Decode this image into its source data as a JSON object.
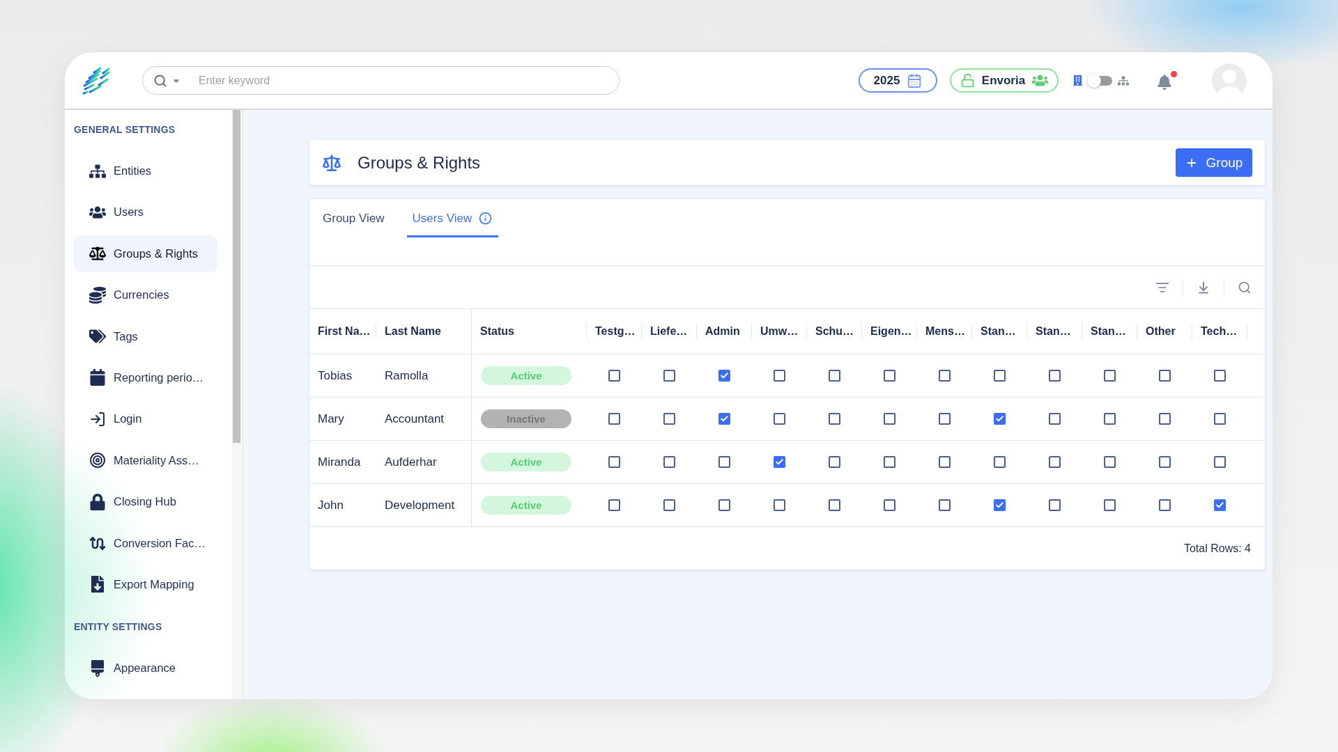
{
  "header": {
    "search": {
      "placeholder": "Enter keyword"
    },
    "year": "2025",
    "entity": "Envoria",
    "view_toggle": {
      "on": false
    },
    "notifications": {
      "unread": true
    }
  },
  "sidebar": {
    "sections": [
      {
        "title": "GENERAL SETTINGS",
        "items": [
          {
            "label": "Entities",
            "selected": false
          },
          {
            "label": "Users",
            "selected": false
          },
          {
            "label": "Groups & Rights",
            "selected": true
          },
          {
            "label": "Currencies",
            "selected": false
          },
          {
            "label": "Tags",
            "selected": false
          },
          {
            "label": "Reporting perio…",
            "selected": false
          },
          {
            "label": "Login",
            "selected": false
          },
          {
            "label": "Materiality Ass…",
            "selected": false
          },
          {
            "label": "Closing Hub",
            "selected": false
          },
          {
            "label": "Conversion Fac…",
            "selected": false
          },
          {
            "label": "Export Mapping",
            "selected": false
          }
        ]
      },
      {
        "title": "ENTITY SETTINGS",
        "items": [
          {
            "label": "Appearance",
            "selected": false
          }
        ]
      }
    ]
  },
  "page": {
    "title": "Groups & Rights",
    "add_button": "Group"
  },
  "tabs": [
    {
      "label": "Group View",
      "selected": false,
      "info": false
    },
    {
      "label": "Users View",
      "selected": true,
      "info": true
    }
  ],
  "table": {
    "columns": [
      "First Na…",
      "Last Name",
      "Status",
      "Testg…",
      "Liefe…",
      "Admin",
      "Umw…",
      "Schu…",
      "Eigen…",
      "Mens…",
      "Stan…",
      "Stan…",
      "Stan…",
      "Other",
      "Tech…"
    ],
    "rows": [
      {
        "first_name": "Tobias",
        "last_name": "Ramolla",
        "status": {
          "label": "Active",
          "active": true
        },
        "rights": [
          {
            "checked": false
          },
          {
            "checked": false
          },
          {
            "checked": true
          },
          {
            "checked": false
          },
          {
            "checked": false
          },
          {
            "checked": false
          },
          {
            "checked": false
          },
          {
            "checked": false
          },
          {
            "checked": false
          },
          {
            "checked": false
          },
          {
            "checked": false
          },
          {
            "checked": false
          }
        ]
      },
      {
        "first_name": "Mary",
        "last_name": "Accountant",
        "status": {
          "label": "Inactive",
          "active": false
        },
        "rights": [
          {
            "checked": false
          },
          {
            "checked": false
          },
          {
            "checked": true
          },
          {
            "checked": false
          },
          {
            "checked": false
          },
          {
            "checked": false
          },
          {
            "checked": false
          },
          {
            "checked": true
          },
          {
            "checked": false
          },
          {
            "checked": false
          },
          {
            "checked": false
          },
          {
            "checked": false
          }
        ]
      },
      {
        "first_name": "Miranda",
        "last_name": "Aufderhar",
        "status": {
          "label": "Active",
          "active": true
        },
        "rights": [
          {
            "checked": false
          },
          {
            "checked": false
          },
          {
            "checked": false
          },
          {
            "checked": true
          },
          {
            "checked": false
          },
          {
            "checked": false
          },
          {
            "checked": false
          },
          {
            "checked": false
          },
          {
            "checked": false
          },
          {
            "checked": false
          },
          {
            "checked": false
          },
          {
            "checked": false
          }
        ]
      },
      {
        "first_name": "John",
        "last_name": "Development",
        "status": {
          "label": "Active",
          "active": true
        },
        "rights": [
          {
            "checked": false
          },
          {
            "checked": false
          },
          {
            "checked": false
          },
          {
            "checked": false
          },
          {
            "checked": false
          },
          {
            "checked": false
          },
          {
            "checked": false
          },
          {
            "checked": true
          },
          {
            "checked": false
          },
          {
            "checked": false
          },
          {
            "checked": false
          },
          {
            "checked": true
          }
        ]
      }
    ],
    "footer": "Total Rows: 4"
  }
}
